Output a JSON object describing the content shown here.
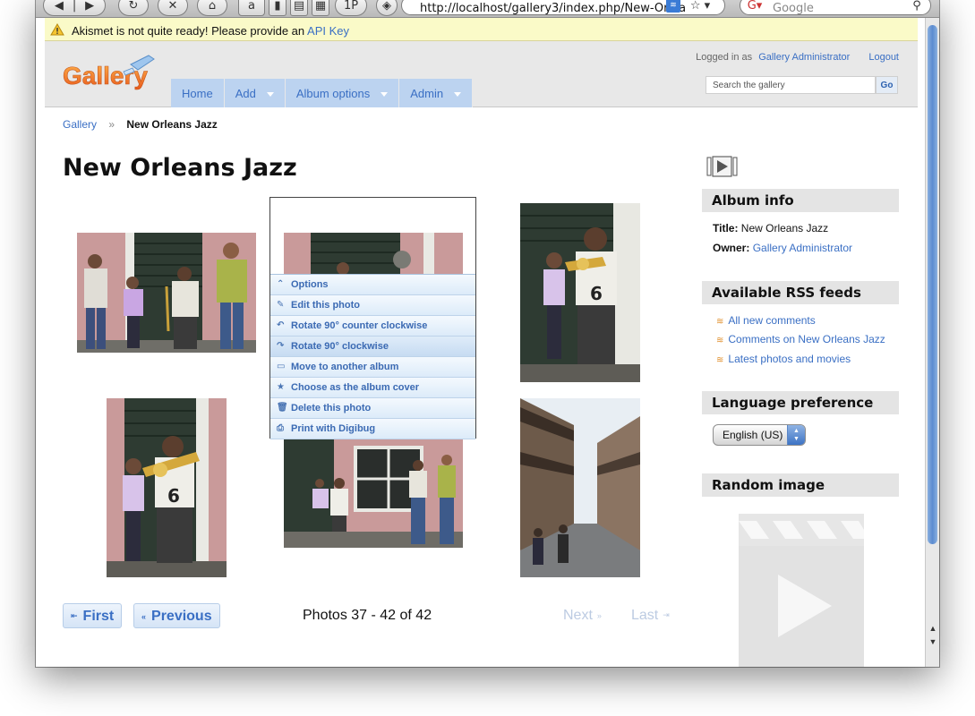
{
  "browser": {
    "url": "http://localhost/gallery3/index.php/New-Orlea",
    "search_placeholder": "Google",
    "onepassword": "1P"
  },
  "notification": {
    "message": "Akismet is not quite ready! Please provide an",
    "link": "API Key"
  },
  "header": {
    "logo_text": "Gallery",
    "logged_in_prefix": "Logged in as",
    "user": "Gallery Administrator",
    "logout": "Logout",
    "search_placeholder": "Search the gallery",
    "search_button": "Go",
    "nav": [
      {
        "label": "Home"
      },
      {
        "label": "Add"
      },
      {
        "label": "Album options"
      },
      {
        "label": "Admin"
      }
    ]
  },
  "breadcrumb": {
    "root": "Gallery",
    "separator": "»",
    "current": "New Orleans Jazz"
  },
  "album": {
    "title": "New Orleans Jazz"
  },
  "context_menu": {
    "items": [
      {
        "label": "Options",
        "icon": "caret-up-icon"
      },
      {
        "label": "Edit this photo",
        "icon": "pencil-icon"
      },
      {
        "label": "Rotate 90° counter clockwise",
        "icon": "rotate-ccw-icon"
      },
      {
        "label": "Rotate 90° clockwise",
        "icon": "rotate-cw-icon"
      },
      {
        "label": "Move to another album",
        "icon": "folder-icon"
      },
      {
        "label": "Choose as the album cover",
        "icon": "star-icon"
      },
      {
        "label": "Delete this photo",
        "icon": "trash-icon"
      },
      {
        "label": "Print with Digibug",
        "icon": "printer-icon"
      }
    ]
  },
  "pager": {
    "first": "First",
    "previous": "Previous",
    "info": "Photos 37 - 42 of 42",
    "next": "Next",
    "last": "Last"
  },
  "sidebar": {
    "album_info": {
      "heading": "Album info",
      "title_label": "Title:",
      "title_value": "New Orleans Jazz",
      "owner_label": "Owner:",
      "owner_value": "Gallery Administrator"
    },
    "rss": {
      "heading": "Available RSS feeds",
      "feeds": [
        "All new comments",
        "Comments on New Orleans Jazz",
        "Latest photos and movies"
      ]
    },
    "language": {
      "heading": "Language preference",
      "selected": "English (US)"
    },
    "random": {
      "heading": "Random image"
    }
  }
}
